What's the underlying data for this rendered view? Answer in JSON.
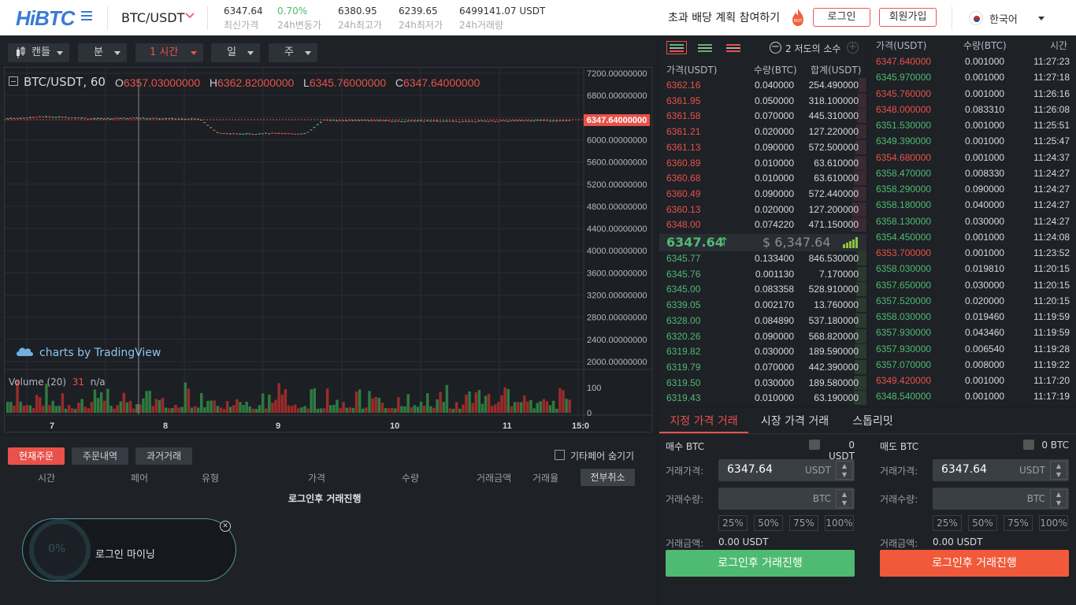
{
  "header": {
    "logo": "HiBTC",
    "pair": "BTC/USDT",
    "stats": [
      {
        "value": "6347.64",
        "label": "최신가격"
      },
      {
        "value": "0.70%",
        "label": "24h변동가"
      },
      {
        "value": "6380.95",
        "label": "24h최고가"
      },
      {
        "value": "6239.65",
        "label": "24h최저가"
      },
      {
        "value": "6499141.07 USDT",
        "label": "24h거래량"
      }
    ],
    "promo": "초과 배당 계획 참여하기",
    "hot_badge": "HOT",
    "login": "로그인",
    "signup": "회원가입",
    "language": "한국어"
  },
  "chart": {
    "timeframes": [
      "캔들",
      "분",
      "1 시간",
      "일",
      "주"
    ],
    "symbol": "BTC/USDT, 60",
    "ohlc": {
      "o_label": "O",
      "o": "6357.03000000",
      "h_label": "H",
      "h": "6362.82000000",
      "l_label": "L",
      "l": "6345.76000000",
      "c_label": "C",
      "c": "6347.64000000"
    },
    "price_ticks": [
      "7200.00000000",
      "6800.00000000",
      "6400.00000000",
      "6000.00000000",
      "5600.00000000",
      "5200.00000000",
      "4800.00000000",
      "4400.00000000",
      "4000.00000000",
      "3600.00000000",
      "3200.00000000",
      "2800.00000000",
      "2400.00000000",
      "2000.00000000"
    ],
    "last_price_tag": "6347.64000000",
    "watermark": "charts by TradingView",
    "volume_label": "Volume (20)",
    "volume_val": "31",
    "volume_na": "n/a",
    "volume_ticks": [
      "100",
      "0"
    ],
    "x_ticks": [
      "7",
      "8",
      "9",
      "10",
      "11",
      "15:0"
    ]
  },
  "chart_data": {
    "type": "candlestick",
    "title": "BTC/USDT, 60",
    "ylim": [
      2000,
      7200
    ],
    "price_series": [
      6385,
      6395,
      6420,
      6410,
      6400,
      6380,
      6385,
      6395,
      6390,
      6380,
      6382,
      6375,
      6120,
      6105,
      6110,
      6118,
      6115,
      6110,
      6358,
      6348,
      6352,
      6350,
      6335,
      6340,
      6342,
      6335,
      6330,
      6338,
      6340,
      6345,
      6352,
      6350,
      6347.64
    ]
  },
  "orders": {
    "tabs": [
      "현재주문",
      "주문내역",
      "과거거래"
    ],
    "hide_other": "기타페어 숨기기",
    "columns": [
      "시간",
      "페어",
      "유형",
      "가격",
      "수량",
      "거래금액",
      "거래율"
    ],
    "cancel_all": "전부취소",
    "empty": "로그인후 거래진행",
    "mining_pct": "0%",
    "mining_label": "로그인 마이닝"
  },
  "orderbook": {
    "decimals": "2 저도의 소수",
    "headers": [
      "가격(USDT)",
      "수량(BTC)",
      "합계(USDT)"
    ],
    "asks": [
      [
        "6362.16",
        "0.040000",
        "254.490000"
      ],
      [
        "6361.95",
        "0.050000",
        "318.100000"
      ],
      [
        "6361.58",
        "0.070000",
        "445.310000"
      ],
      [
        "6361.21",
        "0.020000",
        "127.220000"
      ],
      [
        "6361.13",
        "0.090000",
        "572.500000"
      ],
      [
        "6360.89",
        "0.010000",
        "63.610000"
      ],
      [
        "6360.68",
        "0.010000",
        "63.610000"
      ],
      [
        "6360.49",
        "0.090000",
        "572.440000"
      ],
      [
        "6360.13",
        "0.020000",
        "127.200000"
      ],
      [
        "6348.00",
        "0.074220",
        "471.150000"
      ]
    ],
    "last": "6347.64",
    "last_usd": "$ 6,347.64",
    "bids": [
      [
        "6345.77",
        "0.133400",
        "846.530000"
      ],
      [
        "6345.76",
        "0.001130",
        "7.170000"
      ],
      [
        "6345.00",
        "0.083358",
        "528.910000"
      ],
      [
        "6339.05",
        "0.002170",
        "13.760000"
      ],
      [
        "6328.00",
        "0.084890",
        "537.180000"
      ],
      [
        "6320.26",
        "0.090000",
        "568.820000"
      ],
      [
        "6319.82",
        "0.030000",
        "189.590000"
      ],
      [
        "6319.79",
        "0.070000",
        "442.390000"
      ],
      [
        "6319.50",
        "0.030000",
        "189.580000"
      ],
      [
        "6319.43",
        "0.010000",
        "63.190000"
      ]
    ]
  },
  "trades": {
    "headers": [
      "가격(USDT)",
      "수량(BTC)",
      "시간"
    ],
    "rows": [
      [
        "6347.640000",
        "0.001000",
        "11:27:23",
        "r"
      ],
      [
        "6345.970000",
        "0.001000",
        "11:27:18",
        "g"
      ],
      [
        "6345.760000",
        "0.001000",
        "11:26:16",
        "r"
      ],
      [
        "6348.000000",
        "0.083310",
        "11:26:08",
        "r"
      ],
      [
        "6351.530000",
        "0.001000",
        "11:25:51",
        "g"
      ],
      [
        "6349.390000",
        "0.001000",
        "11:25:47",
        "g"
      ],
      [
        "6354.680000",
        "0.001000",
        "11:24:37",
        "r"
      ],
      [
        "6358.470000",
        "0.008330",
        "11:24:27",
        "g"
      ],
      [
        "6358.290000",
        "0.090000",
        "11:24:27",
        "g"
      ],
      [
        "6358.180000",
        "0.040000",
        "11:24:27",
        "g"
      ],
      [
        "6358.130000",
        "0.030000",
        "11:24:27",
        "g"
      ],
      [
        "6354.450000",
        "0.001000",
        "11:24:08",
        "g"
      ],
      [
        "6353.700000",
        "0.001000",
        "11:23:52",
        "r"
      ],
      [
        "6358.030000",
        "0.019810",
        "11:20:15",
        "g"
      ],
      [
        "6357.650000",
        "0.030000",
        "11:20:15",
        "g"
      ],
      [
        "6357.520000",
        "0.020000",
        "11:20:15",
        "g"
      ],
      [
        "6358.030000",
        "0.019460",
        "11:19:59",
        "g"
      ],
      [
        "6357.930000",
        "0.043460",
        "11:19:59",
        "g"
      ],
      [
        "6357.930000",
        "0.006540",
        "11:19:28",
        "g"
      ],
      [
        "6357.070000",
        "0.008000",
        "11:19:22",
        "g"
      ],
      [
        "6349.420000",
        "0.001000",
        "11:17:20",
        "r"
      ],
      [
        "6348.540000",
        "0.001000",
        "11:17:19",
        "g"
      ]
    ]
  },
  "trade": {
    "tabs": [
      "지정 가격 거래",
      "시장 가격 거래",
      "스톱리밋"
    ],
    "buy": {
      "title": "매수 BTC",
      "balance": "0 USDT",
      "price_label": "거래가격:",
      "price": "6347.64",
      "price_unit": "USDT",
      "qty_label": "거래수량:",
      "qty_unit": "BTC",
      "total_label": "거래금액:",
      "total": "0.00 USDT",
      "button": "로그인후 거래진행"
    },
    "sell": {
      "title": "매도 BTC",
      "balance": "0 BTC",
      "price_label": "거래가격:",
      "price": "6347.64",
      "price_unit": "USDT",
      "qty_label": "거래수량:",
      "qty_unit": "BTC",
      "total_label": "거래금액:",
      "total": "0.00 USDT",
      "button": "로그인후 거래진행"
    },
    "pcts": [
      "25%",
      "50%",
      "75%",
      "100%"
    ]
  },
  "colors": {
    "red": "#e8524a",
    "green": "#4fbb72",
    "buy": "#4fbb72",
    "sell": "#f05a3a"
  }
}
